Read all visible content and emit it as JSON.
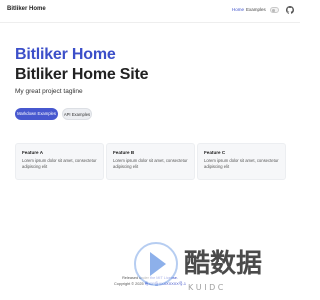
{
  "header": {
    "brand": "Bitliker Home",
    "nav": [
      {
        "label": "Home",
        "active": true
      },
      {
        "label": "Examples",
        "active": false
      }
    ],
    "theme_toggle_icon": "theme-toggle-icon",
    "github_icon": "github-icon"
  },
  "hero": {
    "title_line1": "Bitliker Home",
    "title_line2": "Bitliker Home Site",
    "tagline": "My great project tagline",
    "primary_button": "Markdown Examples",
    "secondary_button": "API Examples"
  },
  "features": [
    {
      "title": "Feature A",
      "details": "Lorem ipsum dolor sit amet, consectetur adipiscing elit"
    },
    {
      "title": "Feature B",
      "details": "Lorem ipsum dolor sit amet, consectetur adipiscing elit"
    },
    {
      "title": "Feature C",
      "details": "Lorem ipsum dolor sit amet, consectetur adipiscing elit"
    }
  ],
  "footer": {
    "released_prefix": "Released under",
    "released_link": "the MIT License.",
    "copyright_prefix": "Copyright © 2025",
    "copyright_link": "粤ICP备XXXXXXXX号-1"
  },
  "watermark": {
    "text": "酷数据",
    "subtext": "K U I D C"
  },
  "colors": {
    "accent": "#3c4fc9",
    "primary_button": "#4758cf",
    "watermark_blue": "#2f6fd8",
    "watermark_dark": "#2b2b2b"
  }
}
